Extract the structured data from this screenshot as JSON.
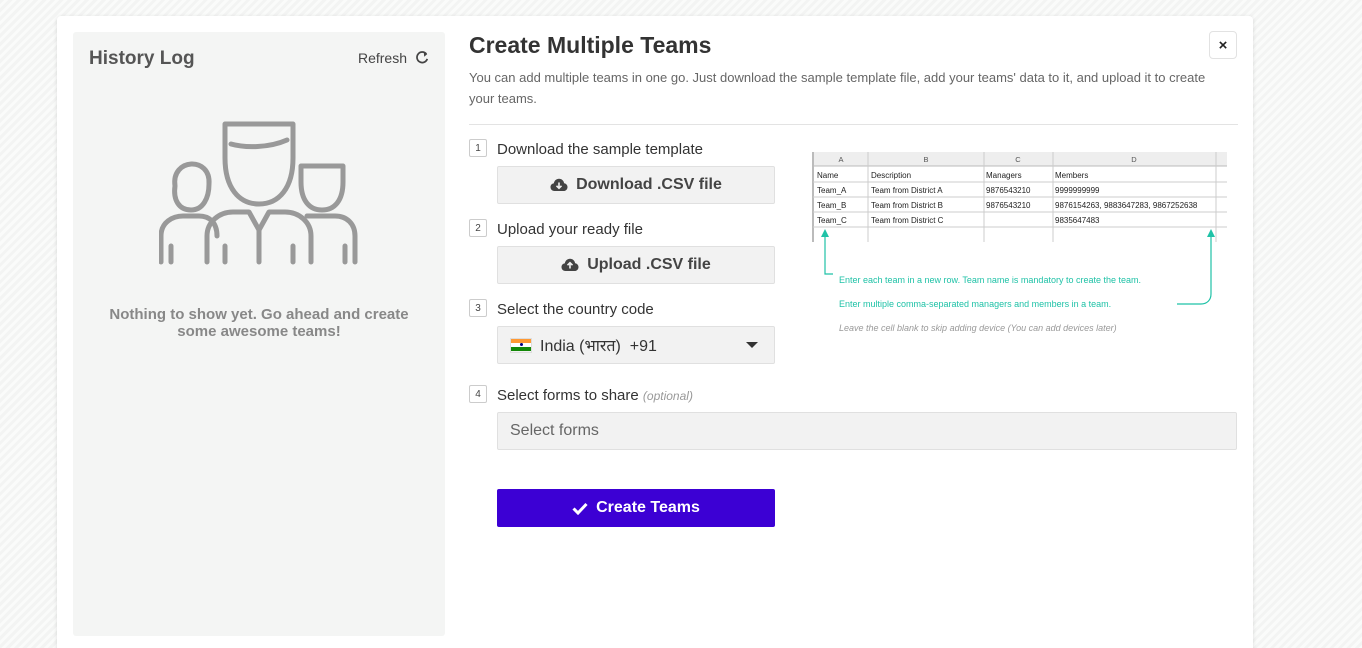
{
  "history": {
    "title": "History Log",
    "refresh_label": "Refresh",
    "empty_message": "Nothing to show yet. Go ahead and create some awesome teams!"
  },
  "main": {
    "title": "Create Multiple Teams",
    "subtitle": "You can add multiple teams in one go. Just download the sample template file, add your teams' data to it, and upload it to create your teams.",
    "close_label": "×",
    "steps": [
      {
        "number": "1",
        "label": "Download the sample template",
        "button": "Download .CSV file"
      },
      {
        "number": "2",
        "label": "Upload your ready file",
        "button": "Upload .CSV file"
      },
      {
        "number": "3",
        "label": "Select the country code",
        "country": "India (भारत)  +91"
      },
      {
        "number": "4",
        "label": "Select forms to share",
        "optional": "(optional)",
        "placeholder": "Select forms"
      }
    ],
    "create_button": "Create Teams"
  },
  "sample_sheet": {
    "columns": [
      "A",
      "B",
      "C",
      "D"
    ],
    "rows": [
      [
        "Name",
        "Description",
        "Managers",
        "Members"
      ],
      [
        "Team_A",
        "Team from District A",
        "9876543210",
        "9999999999"
      ],
      [
        "Team_B",
        "Team from District B",
        "9876543210",
        "9876154263, 9883647283, 9867252638"
      ],
      [
        "Team_C",
        "Team from District C",
        "",
        "9835647483"
      ]
    ],
    "note_1": "Enter each team in a new row. Team name is mandatory to create the team.",
    "note_2": "Enter multiple comma-separated managers and members in a team.",
    "note_3": "Leave the cell blank to skip adding device (You can add devices later)"
  },
  "colors": {
    "primary": "#3c00d4",
    "annotation": "#1fc2a7",
    "flag_saffron": "#ff9933",
    "flag_green": "#138808"
  }
}
